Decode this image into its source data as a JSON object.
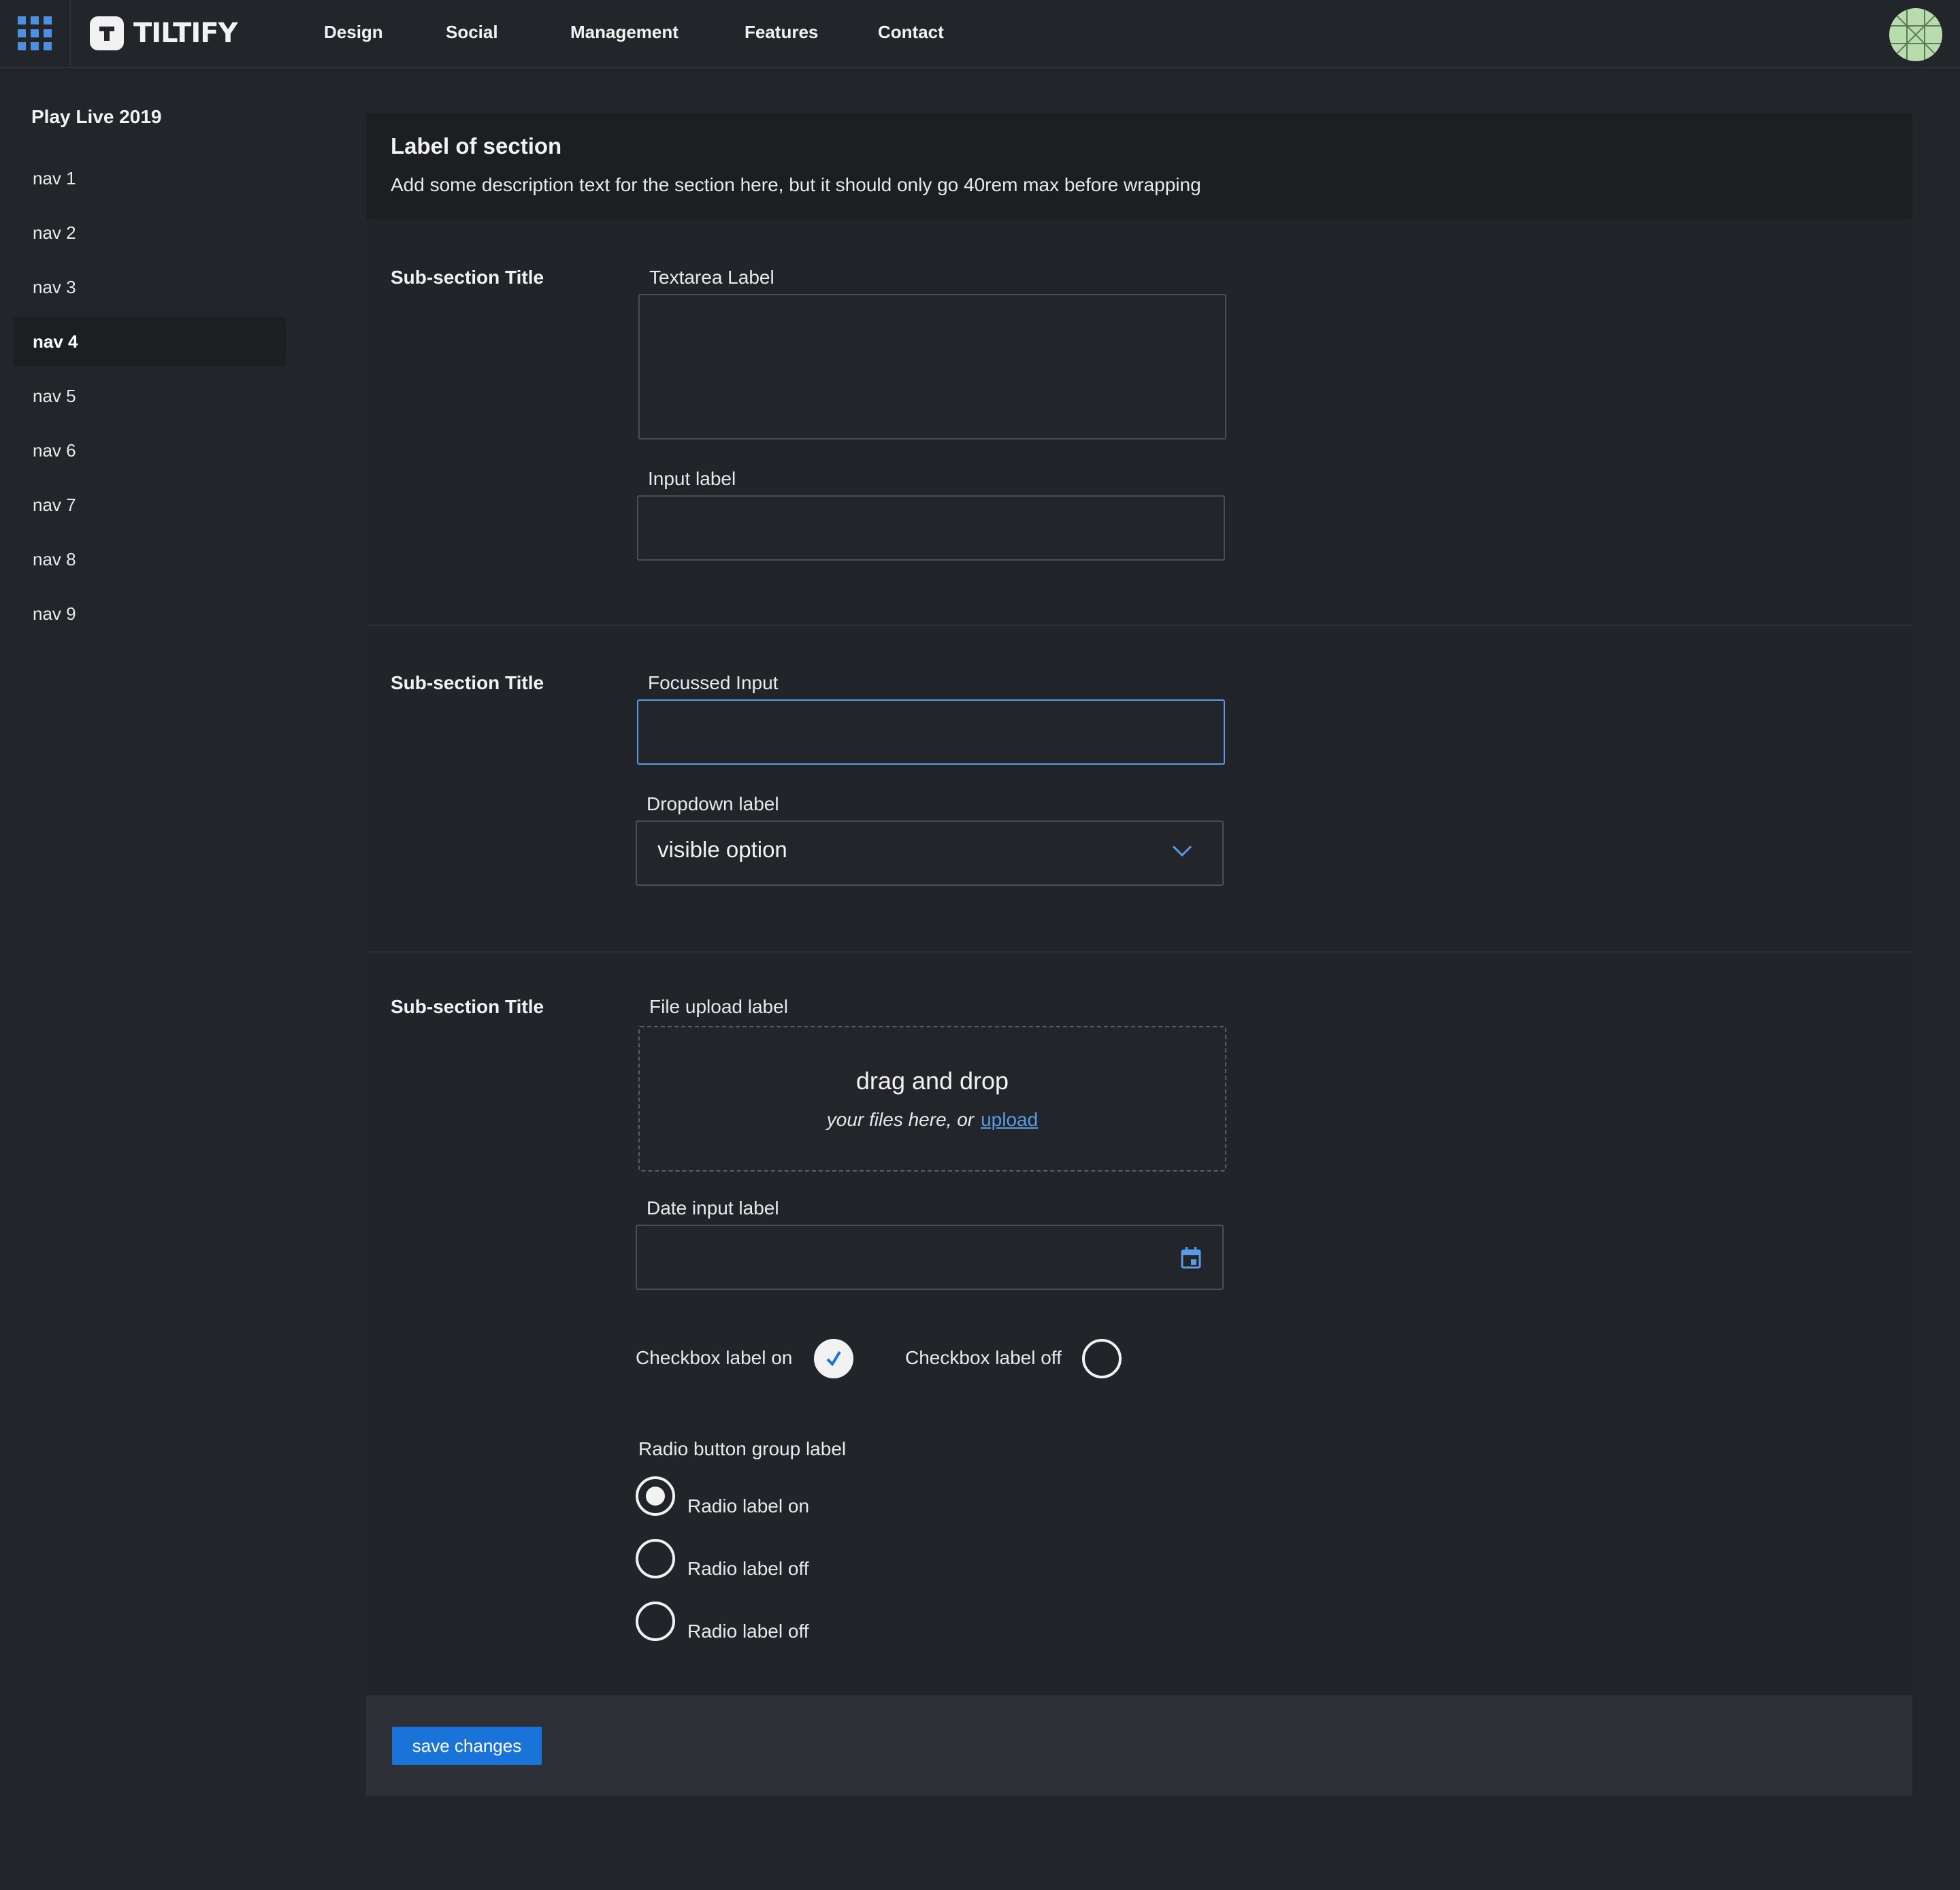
{
  "topbar": {
    "brand": "TILTIFY",
    "nav": [
      "Design",
      "Social",
      "Management",
      "Features",
      "Contact"
    ]
  },
  "sidebar": {
    "title": "Play Live 2019",
    "items": [
      {
        "label": "nav 1",
        "active": false
      },
      {
        "label": "nav 2",
        "active": false
      },
      {
        "label": "nav 3",
        "active": false
      },
      {
        "label": "nav 4",
        "active": true
      },
      {
        "label": "nav 5",
        "active": false
      },
      {
        "label": "nav 6",
        "active": false
      },
      {
        "label": "nav 7",
        "active": false
      },
      {
        "label": "nav 8",
        "active": false
      },
      {
        "label": "nav 9",
        "active": false
      }
    ]
  },
  "section": {
    "title": "Label of section",
    "description": "Add some description text for the section here, but it should only go 40rem max before wrapping"
  },
  "subsections": [
    {
      "title": "Sub-section Title",
      "textarea_label": "Textarea Label",
      "input_label": "Input label"
    },
    {
      "title": "Sub-section Title",
      "focused_input_label": "Focussed Input",
      "dropdown_label": "Dropdown label",
      "dropdown_value": "visible option"
    },
    {
      "title": "Sub-section Title",
      "file_upload_label": "File upload label",
      "upload_main": "drag and drop",
      "upload_sub": "your files here, or",
      "upload_link": "upload",
      "date_label": "Date input label",
      "checkbox_on_label": "Checkbox label on",
      "checkbox_off_label": "Checkbox label off",
      "checkbox_on": true,
      "checkbox_off": false,
      "radio_group_label": "Radio button group label",
      "radios": [
        {
          "label": "Radio label on",
          "selected": true
        },
        {
          "label": "Radio label off",
          "selected": false
        },
        {
          "label": "Radio label off",
          "selected": false
        }
      ]
    }
  ],
  "footer": {
    "save_label": "save changes"
  },
  "colors": {
    "accent": "#1a73d9",
    "focus": "#5a9be6",
    "background": "#222529"
  }
}
